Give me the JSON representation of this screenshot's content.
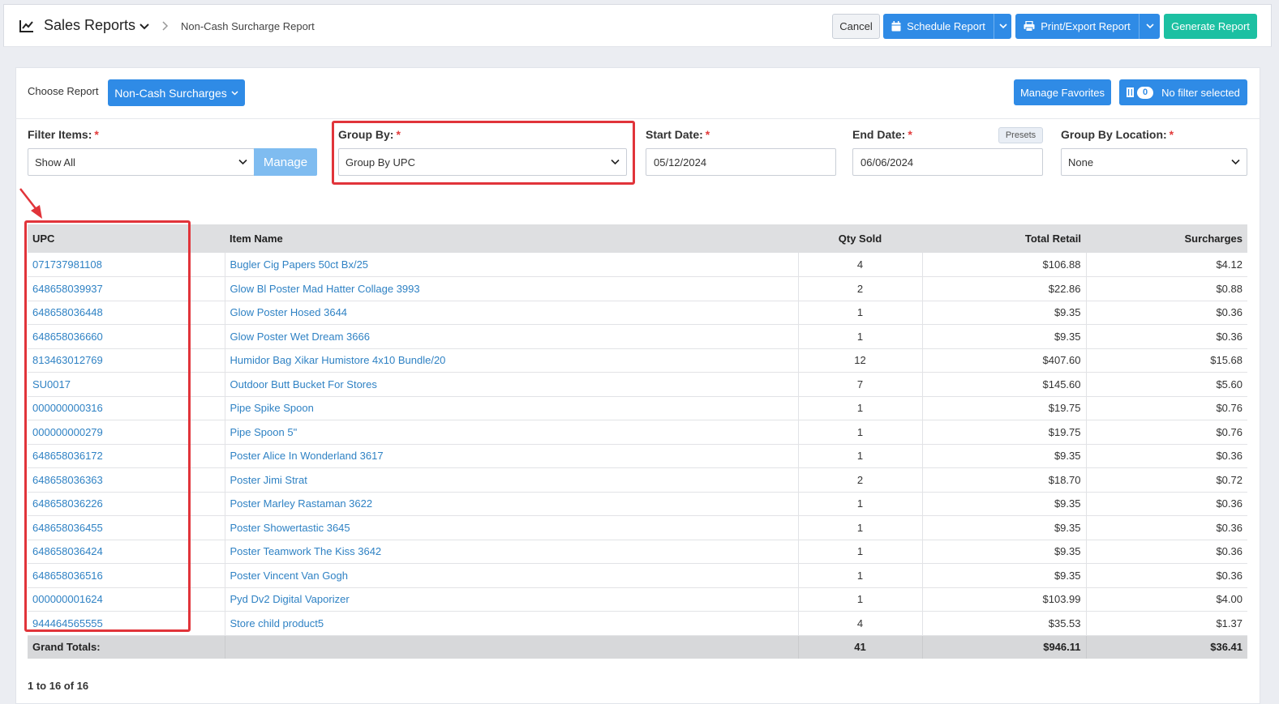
{
  "header": {
    "title": "Sales Reports",
    "breadcrumb": "Non-Cash Surcharge Report",
    "cancel_label": "Cancel",
    "schedule_label": "Schedule Report",
    "print_label": "Print/Export Report",
    "generate_label": "Generate Report"
  },
  "toolbar": {
    "choose_label": "Choose Report",
    "report_value": "Non-Cash Surcharges",
    "favorites_label": "Manage Favorites",
    "filter_count": "0",
    "filter_label": "No filter selected"
  },
  "filters": {
    "filter_items": {
      "label": "Filter Items:",
      "value": "Show All",
      "manage_label": "Manage"
    },
    "group_by": {
      "label": "Group By:",
      "value": "Group By UPC"
    },
    "start_date": {
      "label": "Start Date:",
      "value": "05/12/2024"
    },
    "end_date": {
      "label": "End Date:",
      "value": "06/06/2024",
      "presets_label": "Presets"
    },
    "group_by_location": {
      "label": "Group By Location:",
      "value": "None"
    },
    "required_mark": "*"
  },
  "table": {
    "columns": [
      "UPC",
      "Item Name",
      "Qty Sold",
      "Total Retail",
      "Surcharges"
    ],
    "rows": [
      [
        "071737981108",
        "Bugler Cig Papers 50ct Bx/25",
        "4",
        "$106.88",
        "$4.12"
      ],
      [
        "648658039937",
        "Glow Bl Poster Mad Hatter Collage 3993",
        "2",
        "$22.86",
        "$0.88"
      ],
      [
        "648658036448",
        "Glow Poster Hosed 3644",
        "1",
        "$9.35",
        "$0.36"
      ],
      [
        "648658036660",
        "Glow Poster Wet Dream 3666",
        "1",
        "$9.35",
        "$0.36"
      ],
      [
        "813463012769",
        "Humidor Bag Xikar Humistore 4x10 Bundle/20",
        "12",
        "$407.60",
        "$15.68"
      ],
      [
        "SU0017",
        "Outdoor Butt Bucket For Stores",
        "7",
        "$145.60",
        "$5.60"
      ],
      [
        "000000000316",
        "Pipe Spike Spoon",
        "1",
        "$19.75",
        "$0.76"
      ],
      [
        "000000000279",
        "Pipe Spoon 5\"",
        "1",
        "$19.75",
        "$0.76"
      ],
      [
        "648658036172",
        "Poster Alice In Wonderland 3617",
        "1",
        "$9.35",
        "$0.36"
      ],
      [
        "648658036363",
        "Poster Jimi Strat",
        "2",
        "$18.70",
        "$0.72"
      ],
      [
        "648658036226",
        "Poster Marley Rastaman 3622",
        "1",
        "$9.35",
        "$0.36"
      ],
      [
        "648658036455",
        "Poster Showertastic 3645",
        "1",
        "$9.35",
        "$0.36"
      ],
      [
        "648658036424",
        "Poster Teamwork The Kiss 3642",
        "1",
        "$9.35",
        "$0.36"
      ],
      [
        "648658036516",
        "Poster Vincent Van Gogh",
        "1",
        "$9.35",
        "$0.36"
      ],
      [
        "000000001624",
        "Pyd Dv2 Digital Vaporizer",
        "1",
        "$103.99",
        "$4.00"
      ],
      [
        "944464565555",
        "Store child product5",
        "4",
        "$35.53",
        "$1.37"
      ]
    ],
    "totals": {
      "label": "Grand Totals:",
      "qty": "41",
      "retail": "$946.11",
      "surcharges": "$36.41"
    }
  },
  "pager": "1 to 16 of 16",
  "colors": {
    "primary": "#2f8be6",
    "teal": "#1cc0a2",
    "highlight": "#e1343a",
    "link": "#2f82c4"
  }
}
